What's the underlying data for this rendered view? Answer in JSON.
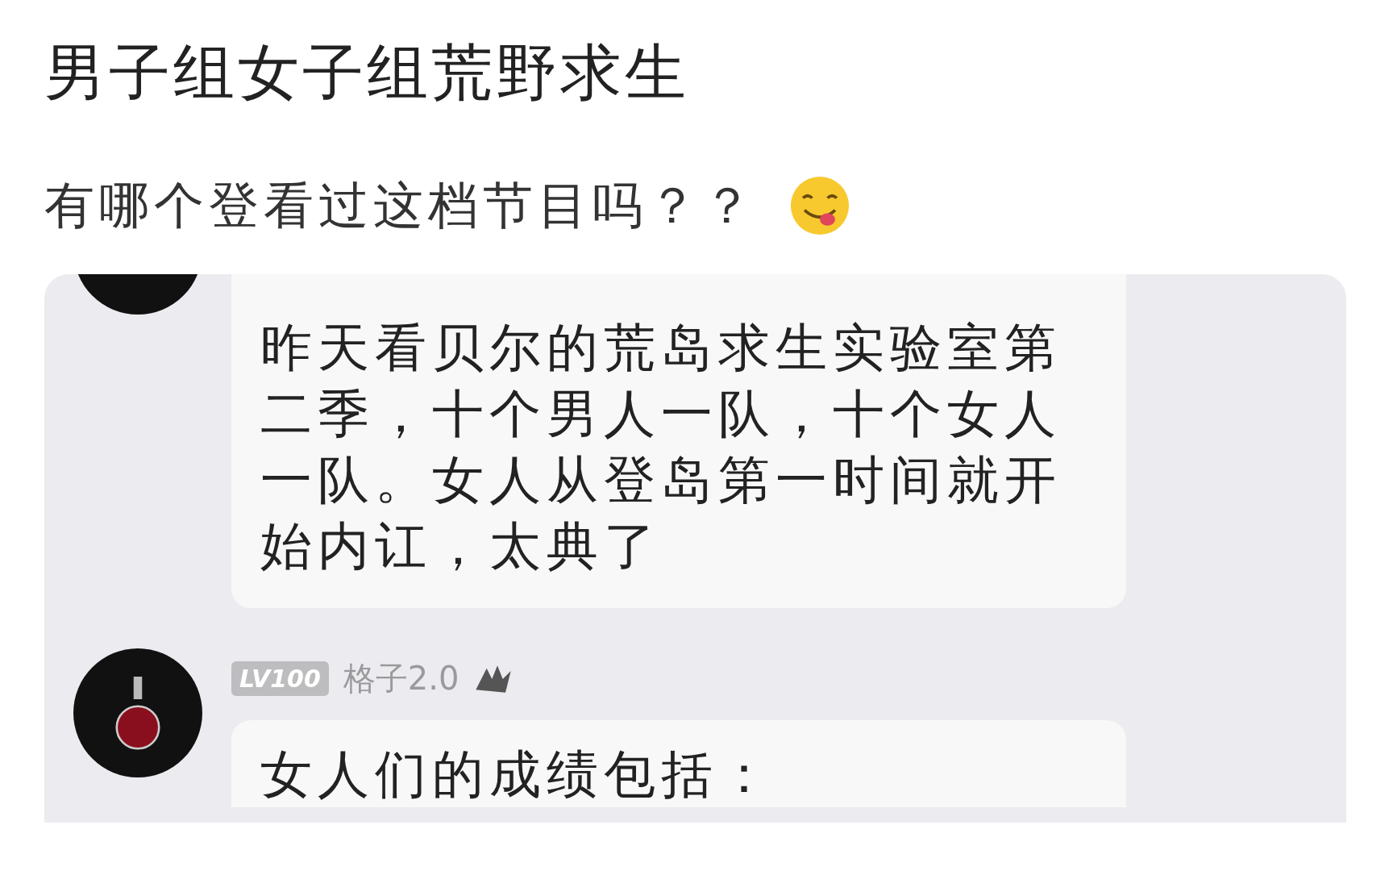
{
  "post": {
    "title": "男子组女子组荒野求生",
    "body": "有哪个登看过这档节目吗？？"
  },
  "chat": {
    "messages": [
      {
        "kind": "continued",
        "text": "昨天看贝尔的荒岛求生实验室第二季，十个男人一队，十个女人一队。女人从登岛第一时间就开始内讧，太典了"
      },
      {
        "kind": "full",
        "level_badge": "LV100",
        "name": "格子2.0",
        "text": "女人们的成绩包括："
      }
    ]
  }
}
